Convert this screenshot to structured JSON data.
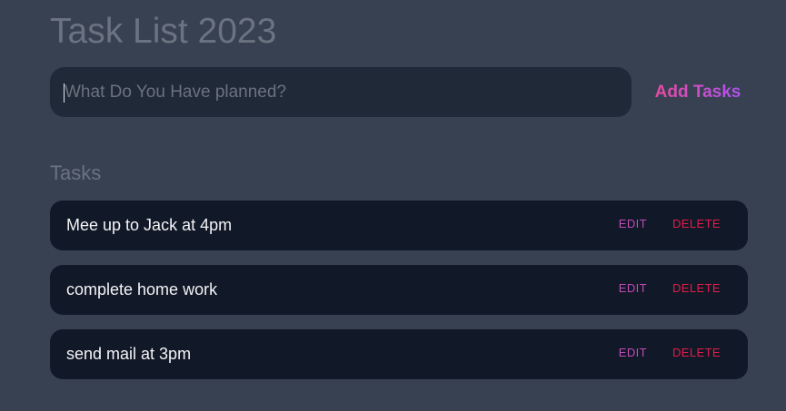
{
  "header": {
    "title": "Task List 2023"
  },
  "form": {
    "input_value": "",
    "input_placeholder": "What Do You Have planned?",
    "add_label": "Add Tasks"
  },
  "tasks_section": {
    "heading": "Tasks",
    "items": [
      {
        "text": "Mee up to Jack at 4pm",
        "edit_label": "EDIT",
        "delete_label": "DELETE"
      },
      {
        "text": "complete home work",
        "edit_label": "EDIT",
        "delete_label": "DELETE"
      },
      {
        "text": "send mail at 3pm",
        "edit_label": "EDIT",
        "delete_label": "DELETE"
      }
    ]
  },
  "colors": {
    "background": "#374151",
    "input_background": "#1f2937",
    "task_background": "#111827",
    "accent_gradient_start": "#ec4899",
    "accent_gradient_end": "#a855f7",
    "edit": "#c04bb6",
    "delete": "#e11d48",
    "muted_text": "#6b7280"
  }
}
